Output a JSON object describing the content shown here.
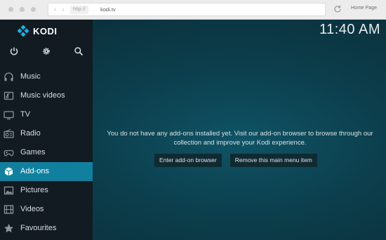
{
  "browser": {
    "protocol": "http://",
    "host": "kodi.tv",
    "nav_arrows": "‹ ›",
    "home_label": "Home Page"
  },
  "app": {
    "name": "KODI",
    "clock": "11:40 AM",
    "top_icons": [
      "power-icon",
      "gear-icon",
      "search-icon"
    ],
    "menu": [
      {
        "label": "Music",
        "icon": "headphones-icon",
        "active": false
      },
      {
        "label": "Music videos",
        "icon": "music-video-icon",
        "active": false
      },
      {
        "label": "TV",
        "icon": "tv-icon",
        "active": false
      },
      {
        "label": "Radio",
        "icon": "radio-icon",
        "active": false
      },
      {
        "label": "Games",
        "icon": "gamepad-icon",
        "active": false
      },
      {
        "label": "Add-ons",
        "icon": "addons-box-icon",
        "active": true
      },
      {
        "label": "Pictures",
        "icon": "picture-icon",
        "active": false
      },
      {
        "label": "Videos",
        "icon": "film-icon",
        "active": false
      },
      {
        "label": "Favourites",
        "icon": "star-icon",
        "active": false
      }
    ],
    "message": "You do not have any add-ons installed yet. Visit our add-on browser to browse through our collection and improve your Kodi experience.",
    "buttons": {
      "enter": "Enter add-on browser",
      "remove": "Remove this main menu item"
    },
    "colors": {
      "sidebar": "#121b22",
      "active": "#11809e",
      "background": "#0c3e4c"
    }
  }
}
